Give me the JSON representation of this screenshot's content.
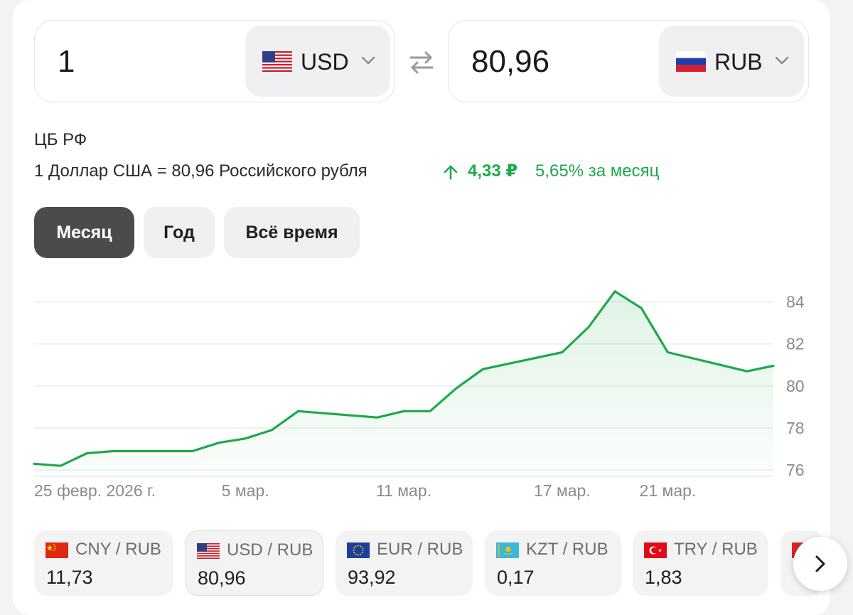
{
  "converter": {
    "from_amount": "1",
    "from_currency": "USD",
    "to_amount": "80,96",
    "to_currency": "RUB"
  },
  "rate_info": {
    "source": "ЦБ РФ",
    "rate_text": "1 Доллар США = 80,96 Российского рубля",
    "change_abs": "4,33 ₽",
    "change_pct": "5,65%  за месяц",
    "change_color": "#1ea94a"
  },
  "periods": [
    {
      "label": "Месяц",
      "active": true
    },
    {
      "label": "Год",
      "active": false
    },
    {
      "label": "Всё время",
      "active": false
    }
  ],
  "chart_data": {
    "type": "area",
    "title": "",
    "xlabel": "",
    "ylabel": "",
    "color": "#1ea94a",
    "ylim": [
      75.7,
      85.0
    ],
    "yticks": [
      "84",
      "82",
      "80",
      "78",
      "76"
    ],
    "x_tick_labels": [
      "25 февр. 2026 г.",
      "5 мар.",
      "11 мар.",
      "17 мар.",
      "21 мар."
    ],
    "grid": true,
    "series": [
      {
        "x": [
          "2026-02-25",
          "2026-02-26",
          "2026-02-27",
          "2026-02-28",
          "2026-03-03",
          "2026-03-04",
          "2026-03-05",
          "2026-03-06",
          "2026-03-07",
          "2026-03-10",
          "2026-03-11",
          "2026-03-12",
          "2026-03-13",
          "2026-03-14",
          "2026-03-17",
          "2026-03-18",
          "2026-03-19",
          "2026-03-20",
          "2026-03-21",
          "2026-03-24",
          "2026-03-25"
        ],
        "values": [
          76.3,
          76.2,
          76.8,
          76.9,
          76.9,
          77.3,
          77.5,
          77.9,
          78.8,
          78.5,
          78.8,
          78.8,
          79.9,
          80.8,
          81.6,
          82.8,
          84.5,
          83.7,
          81.6,
          80.7,
          80.96
        ]
      }
    ]
  },
  "pairs": [
    {
      "name": "CNY / RUB",
      "value": "11,73",
      "flag": "china-flag-icon"
    },
    {
      "name": "USD / RUB",
      "value": "80,96",
      "flag": "usa-flag-icon",
      "selected": true
    },
    {
      "name": "EUR / RUB",
      "value": "93,92",
      "flag": "eu-flag-icon"
    },
    {
      "name": "KZT / RUB",
      "value": "0,17",
      "flag": "kazakhstan-flag-icon"
    },
    {
      "name": "TRY / RUB",
      "value": "1,83",
      "flag": "turkey-flag-icon"
    }
  ]
}
